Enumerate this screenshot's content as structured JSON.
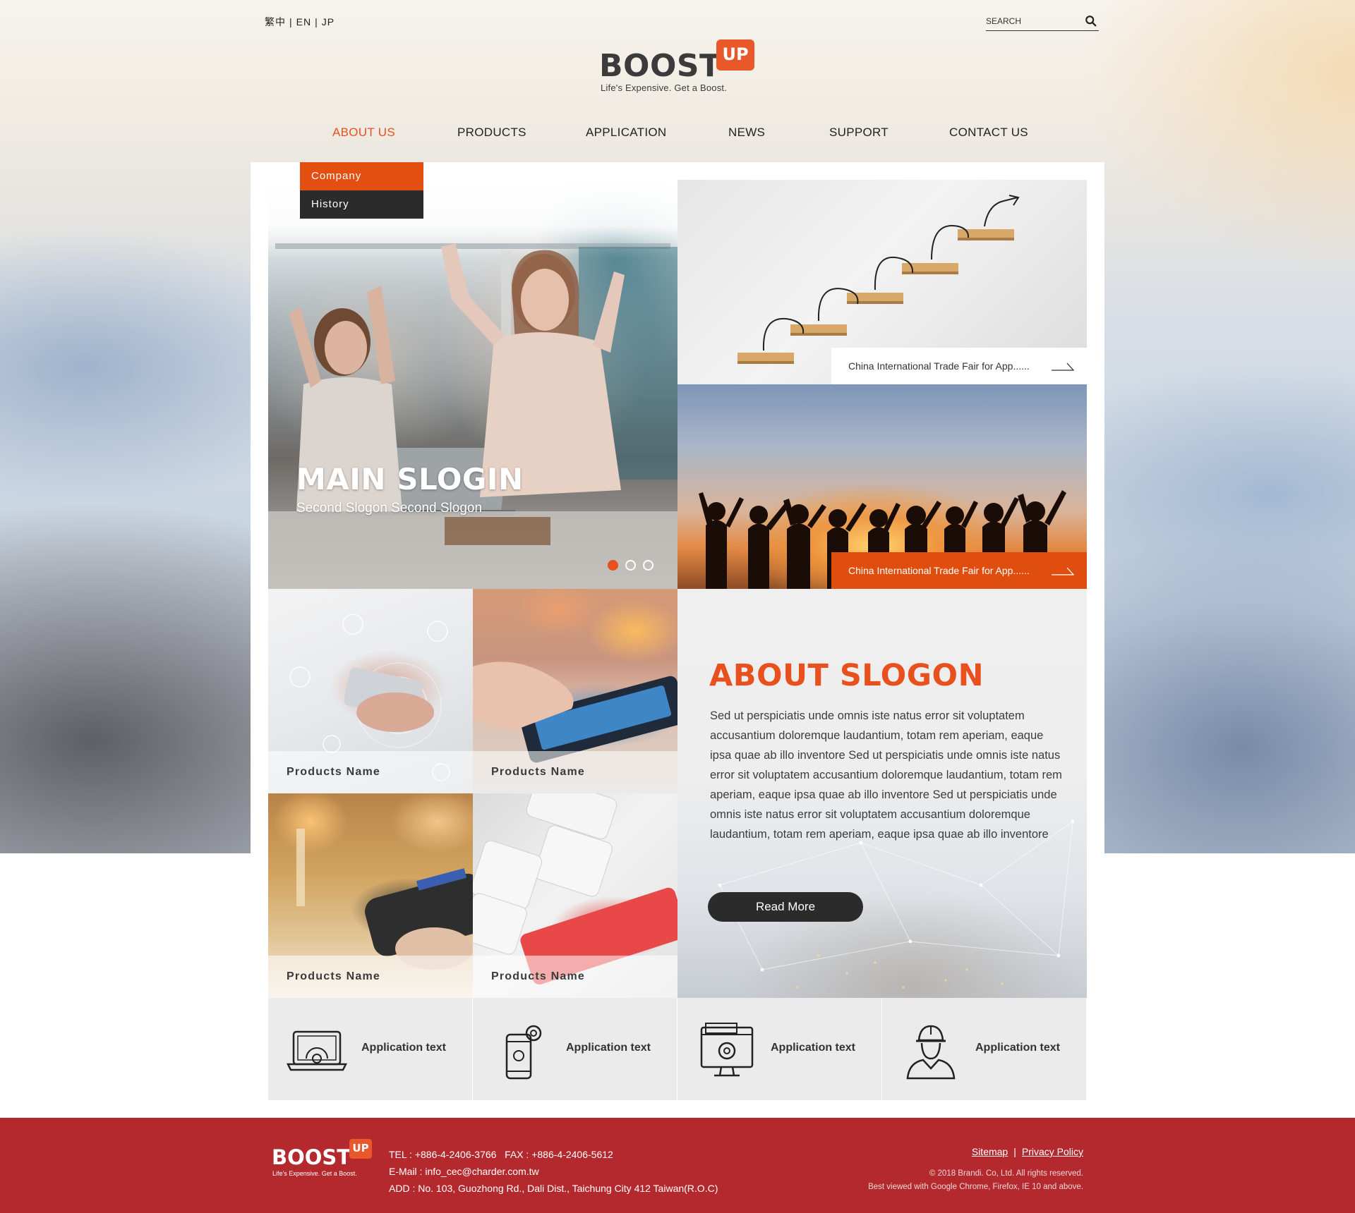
{
  "header": {
    "languages": [
      "繁中",
      "EN",
      "JP"
    ],
    "search_placeholder": "SEARCH"
  },
  "logo": {
    "word": "BOOST",
    "badge": "UP",
    "tagline": "Life's Expensive. Get a Boost."
  },
  "nav": {
    "items": [
      "ABOUT US",
      "PRODUCTS",
      "APPLICATION",
      "NEWS",
      "SUPPORT",
      "CONTACT US"
    ],
    "active": "ABOUT US"
  },
  "dropdown": {
    "items": [
      "Company",
      "History"
    ],
    "selected": "Company"
  },
  "hero": {
    "title": "MAIN SLOGIN",
    "subtitle": "Second Slogon Second Slogon",
    "slides_total": 3,
    "active_slide": 1
  },
  "tiles": [
    {
      "caption": "China International Trade Fair for App......"
    },
    {
      "caption": "China International Trade Fair for App......"
    }
  ],
  "products": [
    "Products Name",
    "Products Name",
    "Products Name",
    "Products Name"
  ],
  "about": {
    "title": "ABOUT SLOGON",
    "text": "Sed ut perspiciatis unde omnis iste natus error sit voluptatem accusantium doloremque laudantium, totam rem aperiam, eaque ipsa quae ab illo inventore Sed ut perspiciatis unde omnis iste natus error sit voluptatem accusantium doloremque laudantium, totam rem aperiam, eaque ipsa quae ab illo inventore Sed ut perspiciatis unde omnis iste natus error sit voluptatem accusantium doloremque laudantium, totam rem aperiam, eaque ipsa quae ab illo inventore",
    "button": "Read More"
  },
  "applications": [
    {
      "icon": "laptop-gear-icon",
      "text": "Application text"
    },
    {
      "icon": "phone-gear-icon",
      "text": "Application text"
    },
    {
      "icon": "monitor-gear-icon",
      "text": "Application text"
    },
    {
      "icon": "engineer-icon",
      "text": "Application text"
    }
  ],
  "footer": {
    "logo_word": "BOOST",
    "logo_badge": "UP",
    "logo_tagline": "Life's Expensive. Get a Boost.",
    "tel": "TEL : +886-4-2406-3766   FAX : +886-4-2406-5612",
    "email": "E-Mail : info_cec@charder.com.tw",
    "address": "ADD : No. 103, Guozhong Rd., Dali Dist., Taichung City 412 Taiwan(R.O.C)",
    "links": [
      "Sitemap",
      "Privacy Policy"
    ],
    "copyright": "© 2018 Brandi. Co, Ltd. All rights reserved.",
    "browsers": "Best viewed with Google Chrome, Firefox, IE 10 and above."
  },
  "colors": {
    "accent": "#e8501e",
    "footer": "#b4292d",
    "dark": "#2b2b2b"
  }
}
